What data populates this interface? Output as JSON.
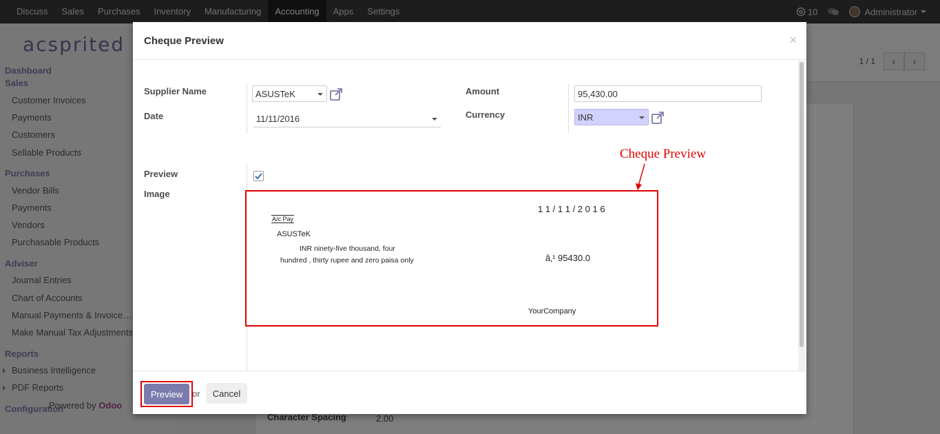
{
  "topbar": {
    "menu": [
      "Discuss",
      "Sales",
      "Purchases",
      "Inventory",
      "Manufacturing",
      "Accounting",
      "Apps",
      "Settings"
    ],
    "active": "Accounting",
    "notif_count": "10",
    "user": "Administrator"
  },
  "sidebar": {
    "logo": "acsprited",
    "dashboard": "Dashboard",
    "sales_header": "Sales",
    "sales_items": [
      "Customer Invoices",
      "Payments",
      "Customers",
      "Sellable Products"
    ],
    "purchases_header": "Purchases",
    "purchases_items": [
      "Vendor Bills",
      "Payments",
      "Vendors",
      "Purchasable Products"
    ],
    "adviser_header": "Adviser",
    "adviser_items": [
      "Journal Entries",
      "Chart of Accounts",
      "Manual Payments & Invoice…",
      "Make Manual Tax Adjustments"
    ],
    "reports_header": "Reports",
    "reports_items": [
      "Business Intelligence",
      "PDF Reports"
    ],
    "config_header": "Configuration",
    "powered_by": "Powered by",
    "powered_brand": "Odoo"
  },
  "background": {
    "pager": "1 / 1",
    "field_label": "Character Spacing",
    "field_value": "2.00"
  },
  "modal": {
    "title": "Cheque Preview",
    "close": "×",
    "supplier_label": "Supplier Name",
    "supplier_value": "ASUSTeK",
    "date_label": "Date",
    "date_value": "11/11/2016",
    "amount_label": "Amount",
    "amount_value": "95,430.00",
    "currency_label": "Currency",
    "currency_value": "INR",
    "preview_label": "Preview",
    "preview_checked": true,
    "image_label": "Image",
    "annotation": "Cheque Preview",
    "cheque": {
      "date": "1 1 / 1 1 / 2 0 1 6",
      "ac_pay": "A/c Pay",
      "payee": "ASUSTeK",
      "words_line1": "INR ninety-five thousand, four",
      "words_line2": "hundred , thirty rupee and zero paisa only",
      "amount": "â‚¹  95430.0",
      "company": "YourCompany"
    },
    "footer": {
      "preview_button": "Preview",
      "or": "or",
      "cancel_button": "Cancel"
    }
  }
}
